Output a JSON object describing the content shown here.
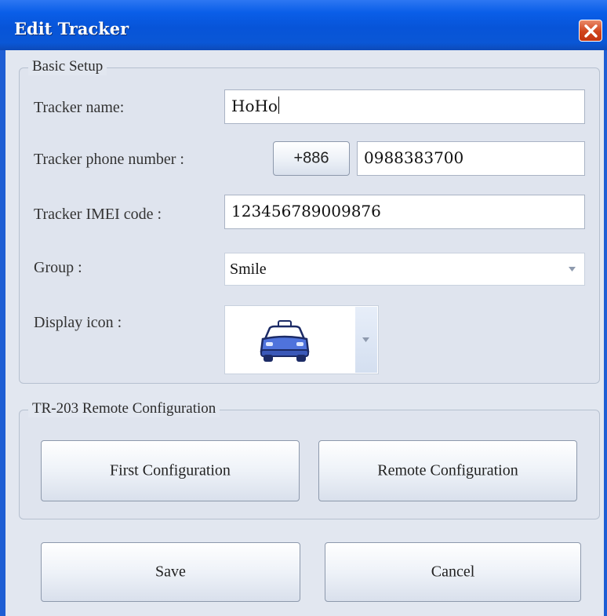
{
  "window": {
    "title": "Edit Tracker",
    "close_icon": "close-icon",
    "titlebar_color": "#0754d8",
    "close_color": "#d0441c"
  },
  "basic_setup": {
    "legend": "Basic Setup",
    "tracker_name": {
      "label": "Tracker  name:",
      "value": "HoHo"
    },
    "phone": {
      "label": "Tracker phone number :",
      "country_code": "+886",
      "value": "0988383700"
    },
    "imei": {
      "label": "Tracker IMEI code :",
      "value": "123456789009876"
    },
    "group": {
      "label": "Group :",
      "selected": "Smile"
    },
    "display_icon": {
      "label": "Display icon :",
      "selected_icon": "taxi-icon",
      "icon_color": "#4a6fd8"
    }
  },
  "remote": {
    "legend": "TR-203 Remote Configuration",
    "first_button": "First Configuration",
    "remote_button": "Remote Configuration"
  },
  "footer": {
    "save_label": "Save",
    "cancel_label": "Cancel"
  }
}
